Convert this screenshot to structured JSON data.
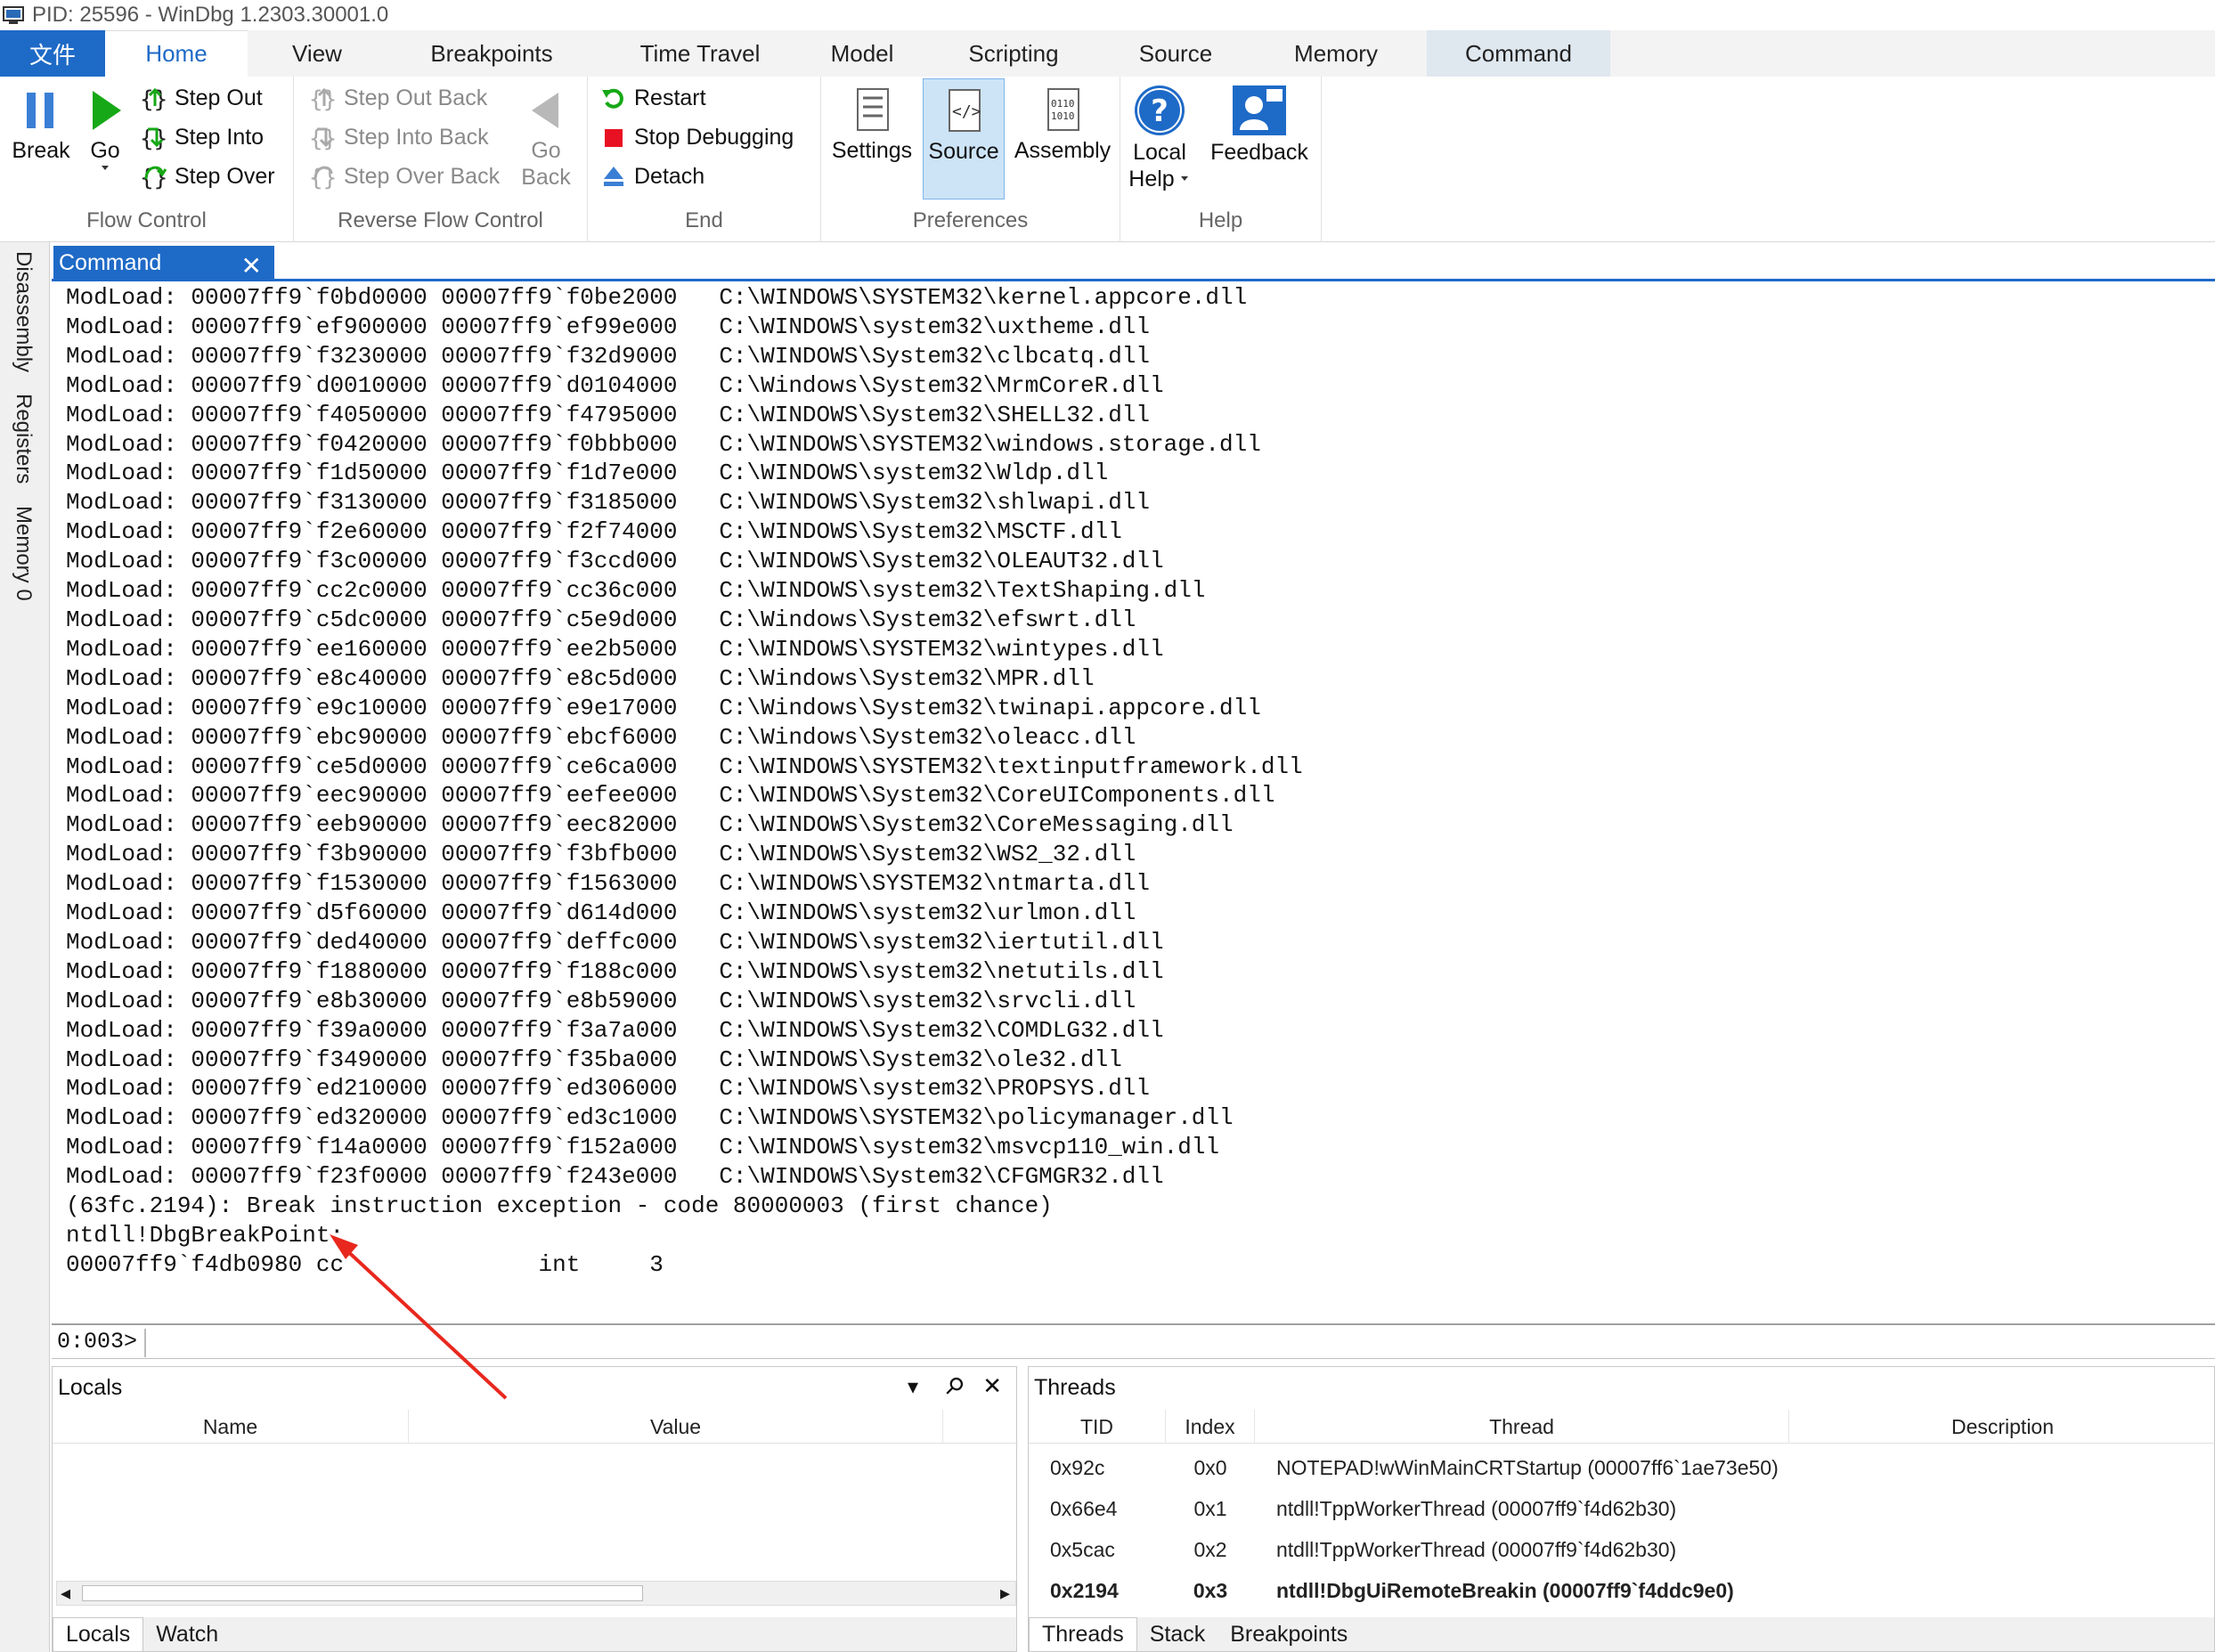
{
  "window": {
    "title": "PID: 25596 - WinDbg 1.2303.30001.0"
  },
  "tabs": [
    {
      "label": "文件"
    },
    {
      "label": "Home"
    },
    {
      "label": "View"
    },
    {
      "label": "Breakpoints"
    },
    {
      "label": "Time Travel"
    },
    {
      "label": "Model"
    },
    {
      "label": "Scripting"
    },
    {
      "label": "Source"
    },
    {
      "label": "Memory"
    },
    {
      "label": "Command"
    }
  ],
  "ribbon": {
    "flow": {
      "label": "Flow Control",
      "break": "Break",
      "go": "Go",
      "step_out": "Step Out",
      "step_into": "Step Into",
      "step_over": "Step Over"
    },
    "reverse": {
      "label": "Reverse Flow Control",
      "step_out_back": "Step Out Back",
      "step_into_back": "Step Into Back",
      "step_over_back": "Step Over Back",
      "go_back_1": "Go",
      "go_back_2": "Back"
    },
    "end": {
      "label": "End",
      "restart": "Restart",
      "stop": "Stop Debugging",
      "detach": "Detach"
    },
    "prefs": {
      "label": "Preferences",
      "settings": "Settings",
      "source": "Source",
      "assembly": "Assembly",
      "asm_glyph_1": "0110",
      "asm_glyph_2": "1010"
    },
    "help": {
      "label": "Help",
      "local_1": "Local",
      "local_2": "Help",
      "feedback": "Feedback",
      "help_glyph": "?"
    }
  },
  "sidebar": {
    "disassembly": "Disassembly",
    "registers": "Registers",
    "memory": "Memory 0"
  },
  "command": {
    "tab_label": "Command",
    "close_glyph": "✕",
    "lines": [
      "ModLoad: 00007ff9`f0bd0000 00007ff9`f0be2000   C:\\WINDOWS\\SYSTEM32\\kernel.appcore.dll",
      "ModLoad: 00007ff9`ef900000 00007ff9`ef99e000   C:\\WINDOWS\\system32\\uxtheme.dll",
      "ModLoad: 00007ff9`f3230000 00007ff9`f32d9000   C:\\WINDOWS\\System32\\clbcatq.dll",
      "ModLoad: 00007ff9`d0010000 00007ff9`d0104000   C:\\Windows\\System32\\MrmCoreR.dll",
      "ModLoad: 00007ff9`f4050000 00007ff9`f4795000   C:\\WINDOWS\\System32\\SHELL32.dll",
      "ModLoad: 00007ff9`f0420000 00007ff9`f0bbb000   C:\\WINDOWS\\SYSTEM32\\windows.storage.dll",
      "ModLoad: 00007ff9`f1d50000 00007ff9`f1d7e000   C:\\WINDOWS\\system32\\Wldp.dll",
      "ModLoad: 00007ff9`f3130000 00007ff9`f3185000   C:\\WINDOWS\\System32\\shlwapi.dll",
      "ModLoad: 00007ff9`f2e60000 00007ff9`f2f74000   C:\\WINDOWS\\System32\\MSCTF.dll",
      "ModLoad: 00007ff9`f3c00000 00007ff9`f3ccd000   C:\\WINDOWS\\System32\\OLEAUT32.dll",
      "ModLoad: 00007ff9`cc2c0000 00007ff9`cc36c000   C:\\WINDOWS\\system32\\TextShaping.dll",
      "ModLoad: 00007ff9`c5dc0000 00007ff9`c5e9d000   C:\\Windows\\System32\\efswrt.dll",
      "ModLoad: 00007ff9`ee160000 00007ff9`ee2b5000   C:\\WINDOWS\\SYSTEM32\\wintypes.dll",
      "ModLoad: 00007ff9`e8c40000 00007ff9`e8c5d000   C:\\Windows\\System32\\MPR.dll",
      "ModLoad: 00007ff9`e9c10000 00007ff9`e9e17000   C:\\Windows\\System32\\twinapi.appcore.dll",
      "ModLoad: 00007ff9`ebc90000 00007ff9`ebcf6000   C:\\Windows\\System32\\oleacc.dll",
      "ModLoad: 00007ff9`ce5d0000 00007ff9`ce6ca000   C:\\WINDOWS\\SYSTEM32\\textinputframework.dll",
      "ModLoad: 00007ff9`eec90000 00007ff9`eefee000   C:\\WINDOWS\\System32\\CoreUIComponents.dll",
      "ModLoad: 00007ff9`eeb90000 00007ff9`eec82000   C:\\WINDOWS\\System32\\CoreMessaging.dll",
      "ModLoad: 00007ff9`f3b90000 00007ff9`f3bfb000   C:\\WINDOWS\\System32\\WS2_32.dll",
      "ModLoad: 00007ff9`f1530000 00007ff9`f1563000   C:\\WINDOWS\\SYSTEM32\\ntmarta.dll",
      "ModLoad: 00007ff9`d5f60000 00007ff9`d614d000   C:\\WINDOWS\\system32\\urlmon.dll",
      "ModLoad: 00007ff9`ded40000 00007ff9`deffc000   C:\\WINDOWS\\system32\\iertutil.dll",
      "ModLoad: 00007ff9`f1880000 00007ff9`f188c000   C:\\WINDOWS\\system32\\netutils.dll",
      "ModLoad: 00007ff9`e8b30000 00007ff9`e8b59000   C:\\WINDOWS\\system32\\srvcli.dll",
      "ModLoad: 00007ff9`f39a0000 00007ff9`f3a7a000   C:\\WINDOWS\\System32\\COMDLG32.dll",
      "ModLoad: 00007ff9`f3490000 00007ff9`f35ba000   C:\\WINDOWS\\System32\\ole32.dll",
      "ModLoad: 00007ff9`ed210000 00007ff9`ed306000   C:\\WINDOWS\\system32\\PROPSYS.dll",
      "ModLoad: 00007ff9`ed320000 00007ff9`ed3c1000   C:\\WINDOWS\\SYSTEM32\\policymanager.dll",
      "ModLoad: 00007ff9`f14a0000 00007ff9`f152a000   C:\\WINDOWS\\system32\\msvcp110_win.dll",
      "ModLoad: 00007ff9`f23f0000 00007ff9`f243e000   C:\\WINDOWS\\System32\\CFGMGR32.dll",
      "(63fc.2194): Break instruction exception - code 80000003 (first chance)",
      "ntdll!DbgBreakPoint:",
      "00007ff9`f4db0980 cc              int     3"
    ],
    "prompt": "0:003>",
    "input_value": ""
  },
  "locals": {
    "title": "Locals",
    "col_name": "Name",
    "col_value": "Value",
    "dropdown_glyph": "▾",
    "pin_glyph": "⚲",
    "close_glyph": "✕",
    "scroll_left": "◂",
    "scroll_right": "▸",
    "tabs": [
      {
        "label": "Locals"
      },
      {
        "label": "Watch"
      }
    ]
  },
  "threads": {
    "title": "Threads",
    "columns": {
      "tid": "TID",
      "index": "Index",
      "thread": "Thread",
      "description": "Description"
    },
    "rows": [
      {
        "tid": "0x92c",
        "index": "0x0",
        "thread": "NOTEPAD!wWinMainCRTStartup (00007ff6`1ae73e50)",
        "description": ""
      },
      {
        "tid": "0x66e4",
        "index": "0x1",
        "thread": "ntdll!TppWorkerThread (00007ff9`f4d62b30)",
        "description": ""
      },
      {
        "tid": "0x5cac",
        "index": "0x2",
        "thread": "ntdll!TppWorkerThread (00007ff9`f4d62b30)",
        "description": ""
      },
      {
        "tid": "0x2194",
        "index": "0x3",
        "thread": "ntdll!DbgUiRemoteBreakin (00007ff9`f4ddc9e0)",
        "description": ""
      }
    ],
    "tabs": [
      {
        "label": "Threads"
      },
      {
        "label": "Stack"
      },
      {
        "label": "Breakpoints"
      }
    ]
  },
  "colors": {
    "accent": "#1e6ac7",
    "annotation_arrow": "#e8281e",
    "stop_red": "#e81123",
    "go_green": "#16a816"
  }
}
